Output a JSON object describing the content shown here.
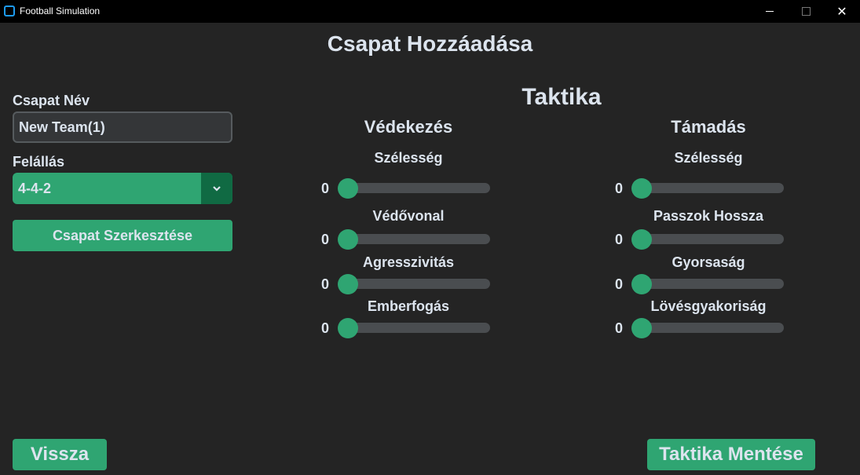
{
  "window": {
    "title": "Football Simulation",
    "minimize": "—",
    "maximize": "□",
    "close": "✕"
  },
  "page": {
    "title": "Csapat Hozzáadása"
  },
  "team_form": {
    "name_label": "Csapat Név",
    "name_value": "New Team(1)",
    "formation_label": "Felállás",
    "formation_value": "4-4-2",
    "edit_button": "Csapat Szerkesztése"
  },
  "tactics": {
    "title": "Taktika",
    "defense": {
      "title": "Védekezés",
      "sliders": [
        {
          "label": "Szélesség",
          "value": "0"
        },
        {
          "label": "Védővonal",
          "value": "0"
        },
        {
          "label": "Agresszivitás",
          "value": "0"
        },
        {
          "label": "Emberfogás",
          "value": "0"
        }
      ]
    },
    "attack": {
      "title": "Támadás",
      "sliders": [
        {
          "label": "Szélesség",
          "value": "0"
        },
        {
          "label": "Passzok Hossza",
          "value": "0"
        },
        {
          "label": "Gyorsaság",
          "value": "0"
        },
        {
          "label": "Lövésgyakoriság",
          "value": "0"
        }
      ]
    }
  },
  "footer": {
    "back_button": "Vissza",
    "save_button": "Taktika Mentése"
  },
  "icons": {
    "dropdown": "chevron-down-icon",
    "app": "app-icon"
  },
  "colors": {
    "accent": "#2fa572",
    "accent_dark": "#106a43",
    "background": "#242424",
    "track": "#4a4d50"
  }
}
